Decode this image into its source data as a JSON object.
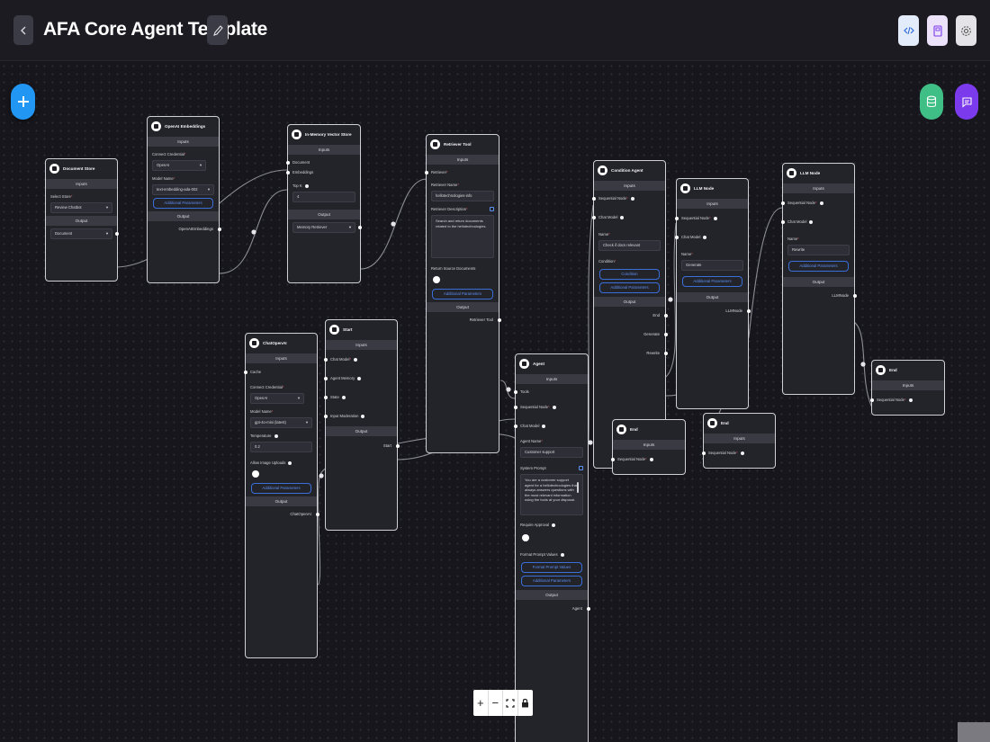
{
  "header": {
    "title": "AFA Core Agent Template",
    "icons": {
      "back": "chevron-left-icon",
      "edit": "pencil-icon",
      "code": "code-icon",
      "save": "save-icon",
      "settings": "gear-icon"
    },
    "colors": {
      "code_bg": "#e3ecfb",
      "save_bg": "#ece3fa",
      "settings_bg": "#e3e3e8"
    }
  },
  "fabs": {
    "add": {
      "icon": "plus-icon",
      "color": "#2196f3"
    },
    "database": {
      "icon": "database-icon",
      "color": "#3fbf86"
    },
    "chat": {
      "icon": "chat-icon",
      "color": "#7c3aed"
    }
  },
  "common": {
    "inputs": "Inputs",
    "output": "Output",
    "additional_parameters": "Additional Parameters"
  },
  "nodes": {
    "document_store": {
      "title": "Document Store",
      "select_store_label": "Select Store",
      "select_store_value": "Review Chatbot",
      "output_value": "Document"
    },
    "openai_embeddings": {
      "title": "OpenAI Embeddings",
      "connect_credential_label": "Connect Credential",
      "credential_value": "OpenAI",
      "model_name_label": "Model Name",
      "model_name_value": "text-embedding-ada-002",
      "output_label": "OpenAIEmbeddings"
    },
    "in_memory_vector_store": {
      "title": "In-Memory Vector Store",
      "document_label": "Document",
      "embeddings_label": "Embeddings",
      "topk_label": "Top K",
      "topk_value": "4",
      "output_value": "Memory Retriever"
    },
    "retriever_tool": {
      "title": "Retriever Tool",
      "retriever_label": "Retriever",
      "retriever_name_label": "Retriever Name",
      "retriever_name_value": "hellotechnologies-info",
      "retriever_description_label": "Retriever Description",
      "retriever_description_value": "Search and return documents related to the hellotechnologies.",
      "return_source_label": "Return Source Documents",
      "output_label": "Retriever Tool"
    },
    "chat_openai": {
      "title": "ChatOpenAI",
      "cache_label": "Cache",
      "connect_credential_label": "Connect Credential",
      "credential_value": "OpenAI",
      "model_name_label": "Model Name",
      "model_name_value": "gpt-4o-mini (latest)",
      "temperature_label": "Temperature",
      "temperature_value": "0.2",
      "allow_image_label": "Allow Image Uploads",
      "output_label": "ChatOpenAI"
    },
    "start": {
      "title": "Start",
      "chat_model_label": "Chat Model",
      "agent_memory_label": "Agent Memory",
      "state_label": "State",
      "input_moderation_label": "Input Moderation",
      "output_label": "Start"
    },
    "agent": {
      "title": "Agent",
      "tools_label": "Tools",
      "sequential_node_label": "Sequential Node",
      "chat_model_label": "Chat Model",
      "agent_name_label": "Agent Name",
      "agent_name_value": "Customer support",
      "system_prompt_label": "System Prompt",
      "system_prompt_value": "You are a customer support agent for a hellotechnologies that always answers questions with the most relevant information using the tools at your disposal.",
      "require_approval_label": "Require Approval",
      "format_prompt_label": "Format Prompt Values",
      "format_prompt_button": "Format Prompt Values",
      "output_label": "Agent"
    },
    "condition_agent": {
      "title": "Condition Agent",
      "sequential_node_label": "Sequential Node",
      "chat_model_label": "Chat Model",
      "name_label": "Name",
      "name_value": "Check if docs relevant",
      "condition_label": "Condition",
      "condition_button": "Condition",
      "output_end": "End",
      "output_generate": "Generate",
      "output_rewrite": "Rewrite"
    },
    "llm_node_generate": {
      "title": "LLM Node",
      "sequential_node_label": "Sequential Node",
      "chat_model_label": "Chat Model",
      "name_label": "Name",
      "name_value": "Generate",
      "output_label": "LLMNode"
    },
    "llm_node_rewrite": {
      "title": "LLM Node",
      "sequential_node_label": "Sequential Node",
      "chat_model_label": "Chat Model",
      "name_label": "Name",
      "name_value": "Rewrite",
      "output_label": "LLMNode"
    },
    "end_1": {
      "title": "End",
      "sequential_node_label": "Sequential Node"
    },
    "end_2": {
      "title": "End",
      "sequential_node_label": "Sequential Node"
    },
    "end_3": {
      "title": "End",
      "sequential_node_label": "Sequential Node"
    }
  },
  "zoom_controls": {
    "zoom_in": "+",
    "zoom_out": "−",
    "icons": [
      "plus-icon",
      "minus-icon",
      "fit-view-icon",
      "lock-icon"
    ]
  }
}
